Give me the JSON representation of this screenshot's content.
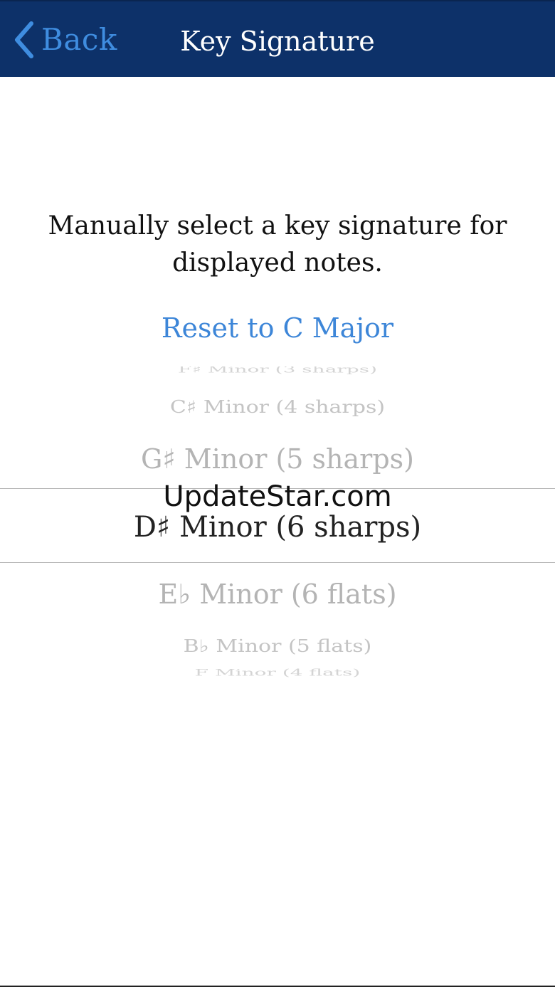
{
  "nav": {
    "back_label": "Back",
    "title": "Key Signature"
  },
  "content": {
    "description": "Manually select a key signature for displayed notes.",
    "reset_label": "Reset to C Major"
  },
  "picker": {
    "rows": [
      "F♯ Minor (3 sharps)",
      "C♯ Minor (4 sharps)",
      "G♯ Minor (5 sharps)",
      "D♯ Minor (6 sharps)",
      "E♭ Minor (6 flats)",
      "B♭ Minor (5 flats)",
      "F Minor (4 flats)"
    ],
    "selected": "D♯ Minor (6 sharps)"
  },
  "watermark": "UpdateStar.com",
  "colors": {
    "nav_background": "#0d3169",
    "accent": "#3d86d8",
    "nav_title": "#ffffff"
  },
  "icons": {
    "back": "chevron-left-icon"
  }
}
